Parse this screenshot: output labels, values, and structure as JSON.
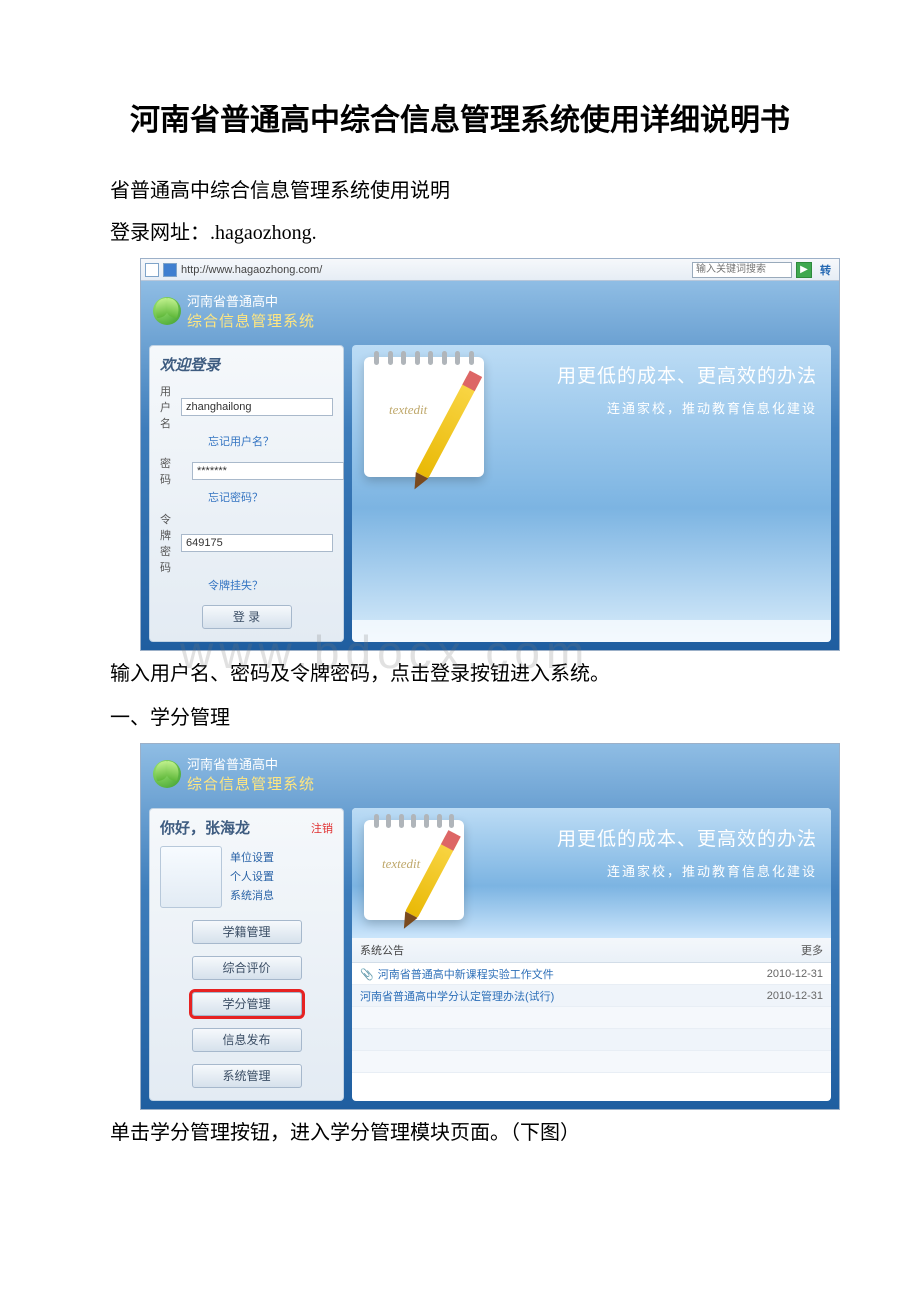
{
  "doc": {
    "title": "河南省普通高中综合信息管理系统使用详细说明书",
    "p1": "省普通高中综合信息管理系统使用说明",
    "p2": "登录网址：.hagaozhong.",
    "p3": "输入用户名、密码及令牌密码，点击登录按钮进入系统。",
    "sec1": "一、学分管理",
    "p4": "单击学分管理按钮，进入学分管理模块页面。（下图）"
  },
  "shot1": {
    "url": "http://www.hagaozhong.com/",
    "search_placeholder": "输入关键词搜索",
    "go_label": "转",
    "brand_line1": "河南省普通高中",
    "brand_line2": "综合信息管理系统",
    "panel_title": "欢迎登录",
    "user_label": "用 户 名",
    "user_value": "zhanghailong",
    "user_forgot": "忘记用户名？",
    "pwd_label": "密　码",
    "pwd_value": "*******",
    "pwd_forgot": "忘记密码？",
    "token_label": "令牌密码",
    "token_value": "649175",
    "token_lost": "令牌挂失？",
    "login_btn": "登 录",
    "slogan1": "用更低的成本、更高效的办法",
    "slogan2": "连通家校，推动教育信息化建设",
    "notepad_text": "textedit",
    "watermark": "www.bdocx.com"
  },
  "shot2": {
    "brand_line1": "河南省普通高中",
    "brand_line2": "综合信息管理系统",
    "hello_prefix": "你好，",
    "user_name": "张海龙",
    "logout": "注销",
    "link_unit": "单位设置",
    "link_personal": "个人设置",
    "link_msg": "系统消息",
    "menu": {
      "m1": "学籍管理",
      "m2": "综合评价",
      "m3": "学分管理",
      "m4": "信息发布",
      "m5": "系统管理"
    },
    "slogan1": "用更低的成本、更高效的办法",
    "slogan2": "连通家校，推动教育信息化建设",
    "notepad_text": "textedit",
    "ann_head": "系统公告",
    "more": "更多",
    "ann": [
      {
        "title": "河南省普通高中新课程实验工作文件",
        "date": "2010-12-31",
        "clip": true
      },
      {
        "title": "河南省普通高中学分认定管理办法(试行)",
        "date": "2010-12-31",
        "clip": false
      }
    ]
  }
}
